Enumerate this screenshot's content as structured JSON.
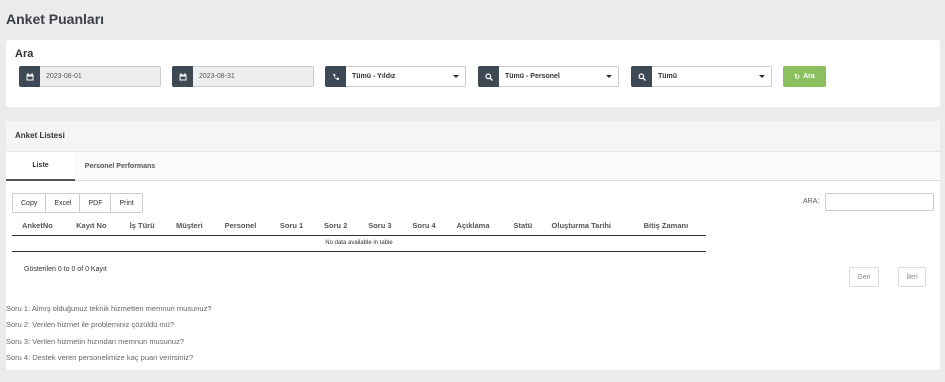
{
  "page": {
    "title": "Anket Puanları"
  },
  "search": {
    "title": "Ara",
    "start_date": "2023-08-01",
    "end_date": "2023-08-31",
    "star_select": "Tümü - Yıldız",
    "personnel_select": "Tümü - Personel",
    "all_select": "Tümü",
    "button_label": "Ara"
  },
  "list": {
    "title": "Anket Listesi",
    "tabs": [
      "Liste",
      "Personel Performans"
    ],
    "export_buttons": [
      "Copy",
      "Excel",
      "PDF",
      "Print"
    ],
    "search_label": "ARA:",
    "columns": [
      "AnketNo",
      "Kayıt No",
      "İş Türü",
      "Müşteri",
      "Personel",
      "Soru 1",
      "Soru 2",
      "Soru 3",
      "Soru 4",
      "Açıklama",
      "Statü",
      "Oluşturma Tarihi",
      "Bitiş Zamanı"
    ],
    "empty_text": "No data available in table",
    "info_text": "Gösterilen 0 to 0 of 0 Kayıt",
    "prev_label": "Geri",
    "next_label": "İleri"
  },
  "questions": [
    "Soru 1: Almış olduğunuz teknik hizmetten memnun musunuz?",
    "Soru 2: Verilen hizmet ile probleminiz çözüldü mü?",
    "Soru 3: Verilen hizmetin hızından memnun musunuz?",
    "Soru 4: Destek veren personelimize kaç puan verirsiniz?"
  ],
  "colors": {
    "accent_green": "#8cc05e",
    "addon_dark": "#3d4a56"
  },
  "icons": {
    "date": "calendar-icon",
    "phone": "phone-icon",
    "search": "search-icon",
    "refresh": "refresh-icon"
  }
}
